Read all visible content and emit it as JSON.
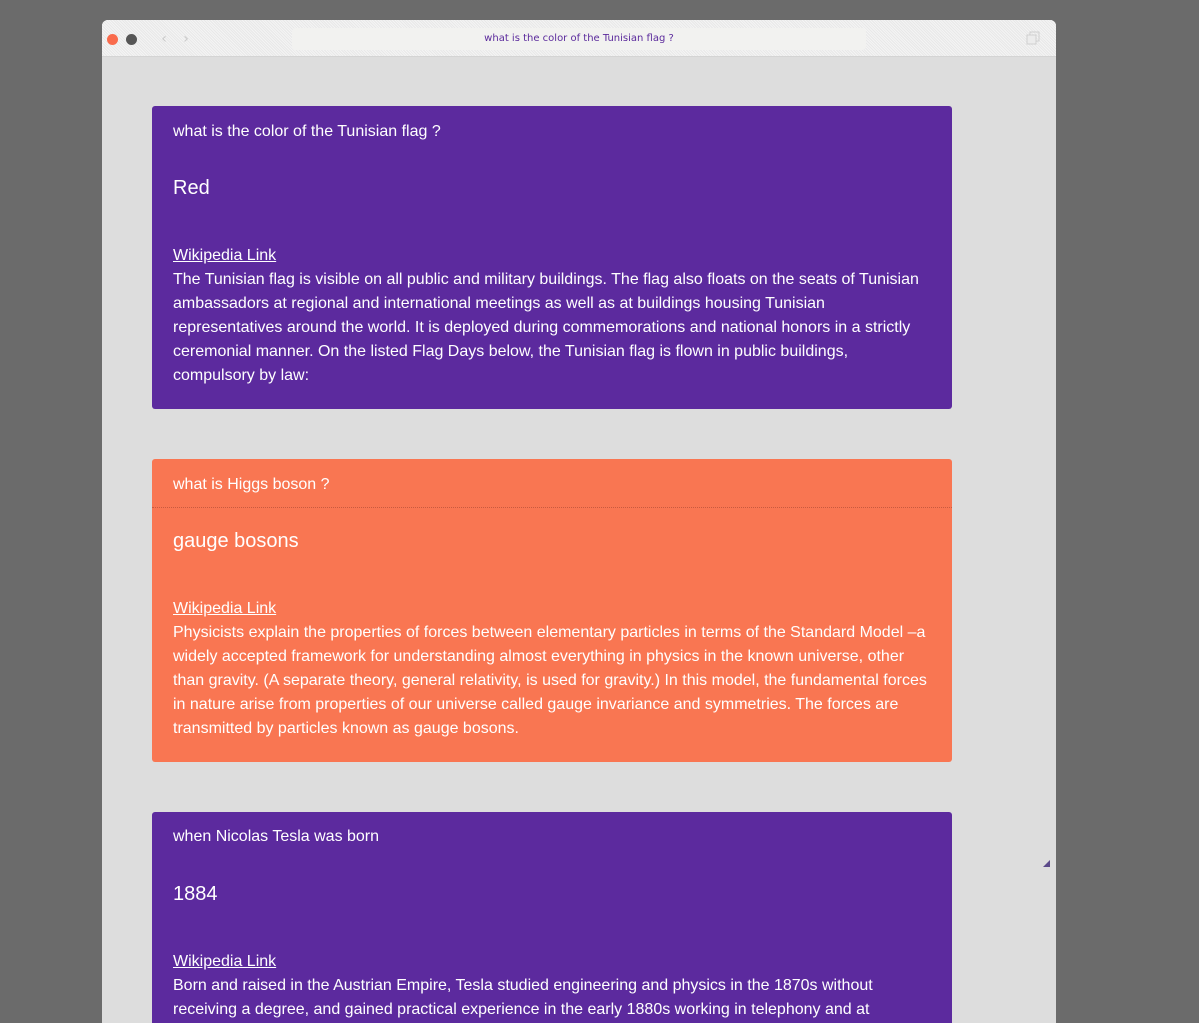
{
  "browser": {
    "address_text": "what is the color of the Tunisian flag ?",
    "back_glyph": "‹",
    "forward_glyph": "›"
  },
  "colors": {
    "purple_card": "#5c2a9e",
    "orange_card": "#f97652",
    "page_background": "#dddddd"
  },
  "cards": [
    {
      "question": "what is the color of the Tunisian flag ?",
      "answer": "Red",
      "link_label": "Wikipedia Link",
      "description": "The Tunisian flag is visible on all public and military buildings. The flag also floats on the seats of Tunisian ambassadors at regional and international meetings as well as at buildings housing Tunisian representatives around the world. It is deployed during commemorations and national honors in a strictly ceremonial manner. On the listed Flag Days below, the Tunisian flag is flown in public buildings, compulsory by law:"
    },
    {
      "question": "what is Higgs boson ?",
      "answer": "gauge bosons",
      "link_label": "Wikipedia Link",
      "description": "Physicists explain the properties of forces between elementary particles in terms of the Standard Model –a widely accepted framework for understanding almost everything in physics in the known universe, other than gravity. (A separate theory, general relativity, is used for gravity.) In this model, the fundamental forces in nature arise from properties of our universe called gauge invariance and symmetries. The forces are transmitted by particles known as gauge bosons."
    },
    {
      "question": "when Nicolas Tesla was born",
      "answer": "1884",
      "link_label": "Wikipedia Link",
      "description": "Born and raised in the Austrian Empire, Tesla studied engineering and physics in the 1870s without receiving a degree, and gained practical experience in the early 1880s working in telephony and at"
    }
  ]
}
